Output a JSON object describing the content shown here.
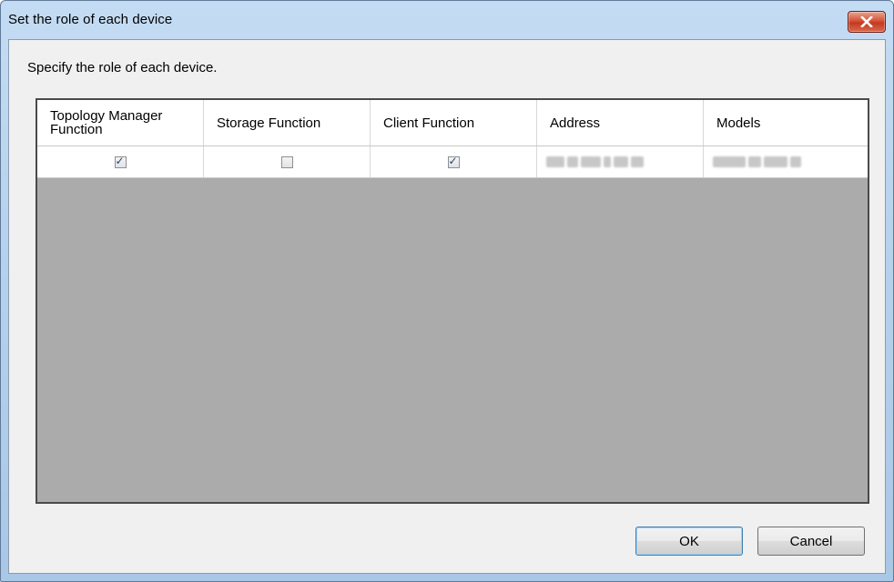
{
  "window": {
    "title": "Set the role of each device",
    "close_icon": "close-icon"
  },
  "dialog": {
    "instruction": "Specify the role of each device."
  },
  "table": {
    "columns": [
      "Topology Manager Function",
      "Storage Function",
      "Client Function",
      "Address",
      "Models"
    ],
    "rows": [
      {
        "topology_manager_function": true,
        "storage_function": false,
        "client_function": true,
        "address_redacted": true,
        "models_redacted": true
      }
    ]
  },
  "buttons": {
    "ok_label": "OK",
    "cancel_label": "Cancel"
  },
  "colors": {
    "titlebar": "#b9d4ee",
    "close_button": "#c7432a",
    "grid_background": "#ababab"
  }
}
